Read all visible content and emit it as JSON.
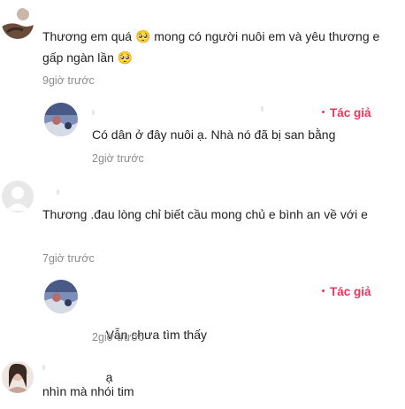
{
  "comments": [
    {
      "text": "Thương em quá 🥺 mong có người nuôi em và yêu thương e gấp ngàn lần 🥺",
      "time": "9giờ trước"
    },
    {
      "author_badge": "Tác giả",
      "text": "Có dân ở đây nuôi ạ. Nhà nó đã bị san bằng",
      "time": "2giờ trước"
    },
    {
      "text": "Thương .đau lòng chỉ biết cầu mong chủ e bình an về với e",
      "time": "7giờ trước"
    },
    {
      "author_badge": "Tác giả",
      "text_before": "Vẫn chưa tìm thấy",
      "text_after": "ạ",
      "time": "2giờ trước"
    },
    {
      "text": "nhìn mà nhói tim"
    }
  ],
  "colors": {
    "author_badge": "#e8365d",
    "meta": "#8c8c8c",
    "text": "#1f1f1f"
  },
  "icons": {
    "avatar_1": "user-avatar-photo",
    "avatar_2": "author-avatar-photo",
    "avatar_3": "default-user-avatar",
    "avatar_4": "author-avatar-photo",
    "avatar_5": "user-avatar-photo"
  }
}
